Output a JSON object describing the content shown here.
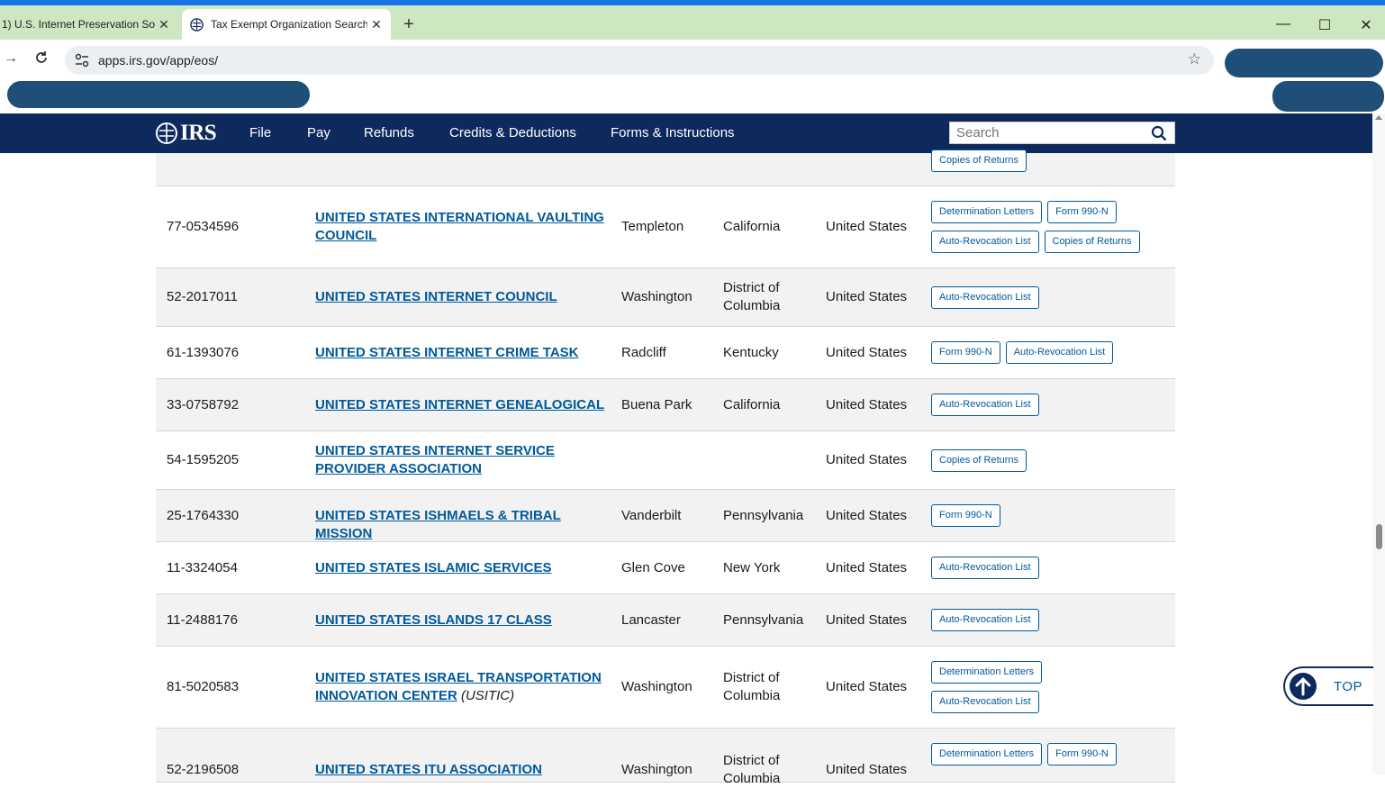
{
  "browser": {
    "tabs": [
      {
        "title": "1) U.S. Internet Preservation So",
        "active": false
      },
      {
        "title": "Tax Exempt Organization Search",
        "active": true
      }
    ],
    "new_tab_label": "+",
    "window_controls": {
      "minimize": "—",
      "maximize": "☐",
      "close": "✕"
    },
    "url": "apps.irs.gov/app/eos/"
  },
  "site_nav": {
    "logo_text": "IRS",
    "items": [
      "File",
      "Pay",
      "Refunds",
      "Credits & Deductions",
      "Forms & Instructions"
    ],
    "search_placeholder": "Search"
  },
  "results": {
    "partial_top_row": {
      "badges": [
        "Copies of Returns"
      ]
    },
    "rows": [
      {
        "ein": "77-0534596",
        "name": "UNITED STATES INTERNATIONAL VAULTING COUNCIL",
        "alias": "",
        "city": "Templeton",
        "state": "California",
        "country": "United States",
        "badges": [
          "Determination Letters",
          "Form 990-N",
          "Auto-Revocation List",
          "Copies of Returns"
        ]
      },
      {
        "ein": "52-2017011",
        "name": "UNITED STATES INTERNET COUNCIL",
        "alias": "",
        "city": "Washington",
        "state": "District of Columbia",
        "country": "United States",
        "badges": [
          "Auto-Revocation List"
        ]
      },
      {
        "ein": "61-1393076",
        "name": "UNITED STATES INTERNET CRIME TASK",
        "alias": "",
        "city": "Radcliff",
        "state": "Kentucky",
        "country": "United States",
        "badges": [
          "Form 990-N",
          "Auto-Revocation List"
        ]
      },
      {
        "ein": "33-0758792",
        "name": "UNITED STATES INTERNET GENEALOGICAL",
        "alias": "",
        "city": "Buena Park",
        "state": "California",
        "country": "United States",
        "badges": [
          "Auto-Revocation List"
        ]
      },
      {
        "ein": "54-1595205",
        "name": "UNITED STATES INTERNET SERVICE PROVIDER ASSOCIATION",
        "alias": "",
        "city": "",
        "state": "",
        "country": "United States",
        "badges": [
          "Copies of Returns"
        ]
      },
      {
        "ein": "25-1764330",
        "name": "UNITED STATES ISHMAELS & TRIBAL MISSION",
        "alias": "",
        "city": "Vanderbilt",
        "state": "Pennsylvania",
        "country": "United States",
        "badges": [
          "Form 990-N"
        ]
      },
      {
        "ein": "11-3324054",
        "name": "UNITED STATES ISLAMIC SERVICES",
        "alias": "",
        "city": "Glen Cove",
        "state": "New York",
        "country": "United States",
        "badges": [
          "Auto-Revocation List"
        ]
      },
      {
        "ein": "11-2488176",
        "name": "UNITED STATES ISLANDS 17 CLASS",
        "alias": "",
        "city": "Lancaster",
        "state": "Pennsylvania",
        "country": "United States",
        "badges": [
          "Auto-Revocation List"
        ]
      },
      {
        "ein": "81-5020583",
        "name": "UNITED STATES ISRAEL TRANSPORTATION INNOVATION CENTER",
        "alias": "(USITIC)",
        "city": "Washington",
        "state": "District of Columbia",
        "country": "United States",
        "badges": [
          "Determination Letters",
          "Auto-Revocation List"
        ]
      },
      {
        "ein": "52-2196508",
        "name": "UNITED STATES ITU ASSOCIATION",
        "alias": "",
        "city": "Washington",
        "state": "District of Columbia",
        "country": "United States",
        "badges": [
          "Determination Letters",
          "Form 990-N"
        ]
      }
    ]
  },
  "top_button": {
    "label": "TOP"
  }
}
